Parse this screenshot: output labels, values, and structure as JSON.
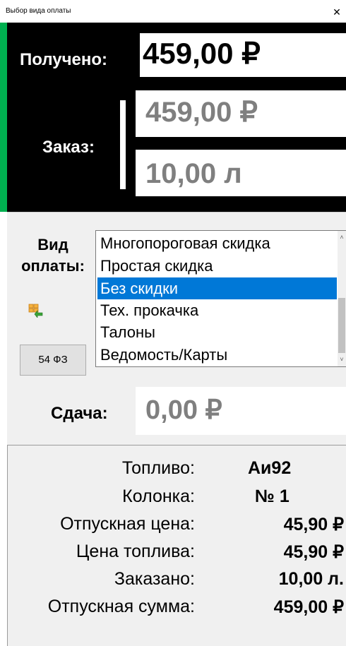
{
  "window": {
    "title": "Выбор вида оплаты",
    "close_glyph": "✕"
  },
  "received": {
    "label": "Получено:",
    "value": "459,00 ₽"
  },
  "order": {
    "label": "Заказ:",
    "amount": "459,00 ₽",
    "volume": "10,00 л"
  },
  "payment": {
    "label": "Вид\nоплаты:",
    "options": [
      "Многопороговая скидка",
      "Простая скидка",
      "Без скидки",
      "Тех. прокачка",
      "Талоны",
      "Ведомость/Карты"
    ],
    "selected": "Без скидки",
    "fz_button": "54 ФЗ",
    "icon": "orders-icon"
  },
  "change": {
    "label": "Сдача:",
    "value": "0,00 ₽"
  },
  "info": {
    "rows": [
      {
        "label": "Топливо:",
        "value": "Аи92"
      },
      {
        "label": "Колонка:",
        "value": "№ 1"
      },
      {
        "label": "Отпускная цена:",
        "value": "45,90 ₽"
      },
      {
        "label": "Цена топлива:",
        "value": "45,90 ₽"
      },
      {
        "label": "Заказано:",
        "value": "10,00 л."
      },
      {
        "label": "Отпускная сумма:",
        "value": "459,00 ₽"
      }
    ]
  },
  "colors": {
    "selection": "#0078d7",
    "panel_black": "#000000",
    "muted_text": "#7f7f7f",
    "accent_green": "#00b050"
  }
}
